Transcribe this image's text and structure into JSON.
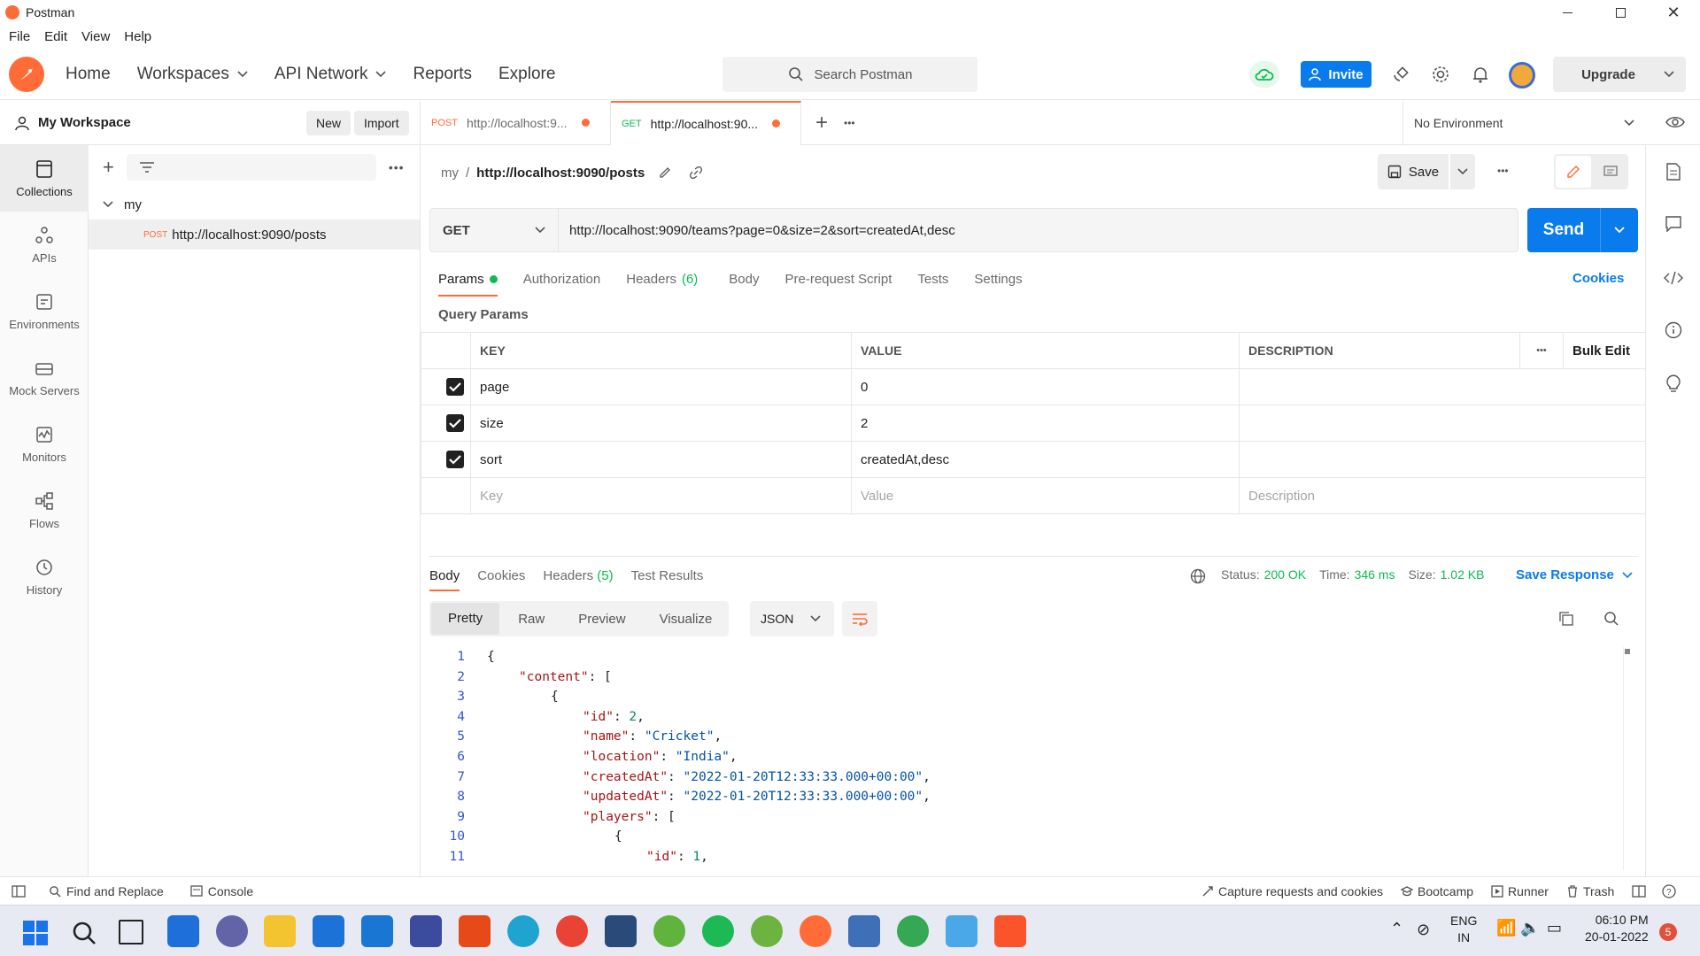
{
  "window": {
    "title": "Postman",
    "menu": [
      "File",
      "Edit",
      "View",
      "Help"
    ]
  },
  "header": {
    "nav": [
      {
        "label": "Home",
        "chevron": false
      },
      {
        "label": "Workspaces",
        "chevron": true
      },
      {
        "label": "API Network",
        "chevron": true
      },
      {
        "label": "Reports",
        "chevron": false
      },
      {
        "label": "Explore",
        "chevron": false
      }
    ],
    "search_placeholder": "Search Postman",
    "invite_label": "Invite",
    "upgrade_label": "Upgrade"
  },
  "workspace": {
    "name": "My Workspace",
    "new_label": "New",
    "import_label": "Import"
  },
  "sidebar": {
    "items": [
      {
        "label": "Collections",
        "icon": "collections-icon"
      },
      {
        "label": "APIs",
        "icon": "apis-icon"
      },
      {
        "label": "Environments",
        "icon": "environments-icon"
      },
      {
        "label": "Mock Servers",
        "icon": "mock-servers-icon"
      },
      {
        "label": "Monitors",
        "icon": "monitors-icon"
      },
      {
        "label": "Flows",
        "icon": "flows-icon"
      },
      {
        "label": "History",
        "icon": "history-icon"
      }
    ],
    "tree": {
      "collection": "my",
      "request_method": "POST",
      "request_url": "http://localhost:9090/posts"
    }
  },
  "tabs": [
    {
      "method": "POST",
      "label": "http://localhost:9...",
      "method_color": "#ff6c37"
    },
    {
      "method": "GET",
      "label": "http://localhost:90...",
      "method_color": "#0cbb52"
    }
  ],
  "environment": "No Environment",
  "request": {
    "breadcrumb_parent": "my",
    "breadcrumb_sep": "/",
    "breadcrumb_name": "http://localhost:9090/posts",
    "save_label": "Save",
    "method": "GET",
    "url": "http://localhost:9090/teams?page=0&size=2&sort=createdAt,desc",
    "send_label": "Send",
    "tabs": [
      "Params",
      "Authorization",
      "Headers",
      "Body",
      "Pre-request Script",
      "Tests",
      "Settings"
    ],
    "headers_count": "(6)",
    "cookies_label": "Cookies",
    "query_params_title": "Query Params",
    "columns": {
      "key": "KEY",
      "value": "VALUE",
      "description": "DESCRIPTION",
      "bulk_edit": "Bulk Edit"
    },
    "params": [
      {
        "key": "page",
        "value": "0"
      },
      {
        "key": "size",
        "value": "2"
      },
      {
        "key": "sort",
        "value": "createdAt,desc"
      }
    ],
    "placeholders": {
      "key": "Key",
      "value": "Value",
      "description": "Description"
    }
  },
  "response": {
    "tabs": [
      "Body",
      "Cookies",
      "Headers",
      "Test Results"
    ],
    "headers_count": "(5)",
    "status_label": "Status:",
    "status_value": "200 OK",
    "time_label": "Time:",
    "time_value": "346 ms",
    "size_label": "Size:",
    "size_value": "1.02 KB",
    "save_response": "Save Response",
    "views": [
      "Pretty",
      "Raw",
      "Preview",
      "Visualize"
    ],
    "format": "JSON",
    "code": [
      {
        "n": "1",
        "indent": 0,
        "html": "{"
      },
      {
        "n": "2",
        "indent": 1,
        "key": "content",
        "rest": ": ["
      },
      {
        "n": "3",
        "indent": 2,
        "html": "{"
      },
      {
        "n": "4",
        "indent": 3,
        "key": "id",
        "num": "2",
        "rest": ","
      },
      {
        "n": "5",
        "indent": 3,
        "key": "name",
        "str": "Cricket",
        "rest": ","
      },
      {
        "n": "6",
        "indent": 3,
        "key": "location",
        "str": "India",
        "rest": ","
      },
      {
        "n": "7",
        "indent": 3,
        "key": "createdAt",
        "str": "2022-01-20T12:33:33.000+00:00",
        "rest": ","
      },
      {
        "n": "8",
        "indent": 3,
        "key": "updatedAt",
        "str": "2022-01-20T12:33:33.000+00:00",
        "rest": ","
      },
      {
        "n": "9",
        "indent": 3,
        "key": "players",
        "rest": ": ["
      },
      {
        "n": "10",
        "indent": 4,
        "html": "{"
      },
      {
        "n": "11",
        "indent": 5,
        "key": "id",
        "num": "1",
        "rest": ","
      }
    ]
  },
  "statusbar": {
    "find_replace": "Find and Replace",
    "console": "Console",
    "capture": "Capture requests and cookies",
    "bootcamp": "Bootcamp",
    "runner": "Runner",
    "trash": "Trash"
  },
  "taskbar": {
    "lang_line1": "ENG",
    "lang_line2": "IN",
    "time": "06:10 PM",
    "date": "20-01-2022",
    "notification_count": "5"
  },
  "colors": {
    "accent": "#ff6c37",
    "primary": "#097bed",
    "status_green": "#0cbb52"
  }
}
